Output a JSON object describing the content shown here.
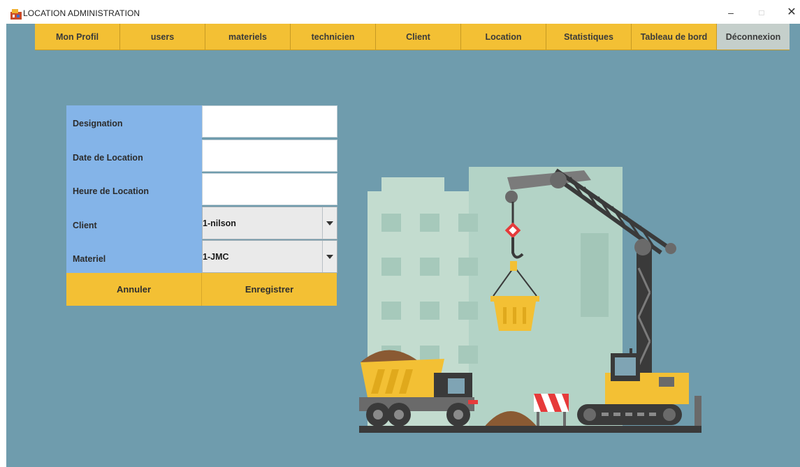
{
  "window": {
    "title": "LOCATION ADMINISTRATION",
    "minimize_glyph": "–",
    "maximize_glyph": "□",
    "close_glyph": "✕"
  },
  "nav": {
    "items": [
      "Mon Profil",
      "users",
      "materiels",
      "technicien",
      "Client",
      "Location",
      "Statistiques",
      "Tableau de bord"
    ],
    "logout": "Déconnexion"
  },
  "form": {
    "labels": {
      "designation": "Designation",
      "date": "Date de Location",
      "heure": "Heure de Location",
      "client": "Client",
      "materiel": "Materiel"
    },
    "values": {
      "designation": "",
      "date": "",
      "heure": "",
      "client": "1-nilson",
      "materiel": "1-JMC"
    },
    "buttons": {
      "cancel": "Annuler",
      "save": "Enregistrer"
    }
  },
  "colors": {
    "background": "#6f9cad",
    "accent": "#f3c034",
    "label_panel": "#84b4e8",
    "logout_button": "#c5cfcb"
  },
  "icons": {
    "app": "app-window-icon",
    "dropdown": "chevron-down-icon",
    "illustration": "construction-crane-truck-illustration"
  }
}
